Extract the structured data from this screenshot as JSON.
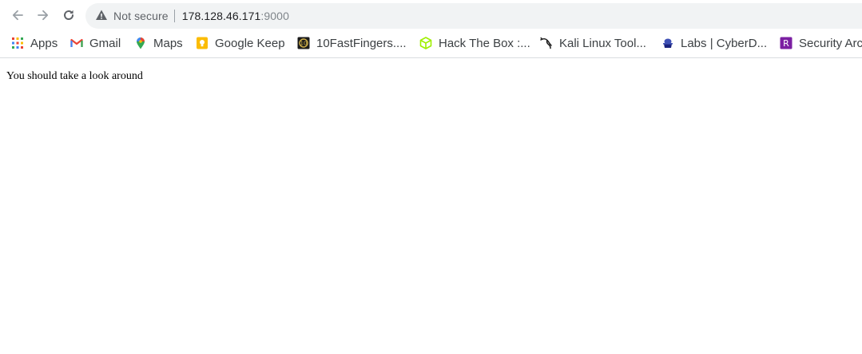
{
  "toolbar": {
    "back_icon": "arrow-left-icon",
    "forward_icon": "arrow-right-icon",
    "reload_icon": "reload-icon"
  },
  "omnibox": {
    "security_icon": "warning-icon",
    "security_label": "Not secure",
    "url_host": "178.128.46.171",
    "url_port": ":9000"
  },
  "bookmarks": [
    {
      "label": "Apps",
      "icon": "apps-grid-icon"
    },
    {
      "label": "Gmail",
      "icon": "gmail-icon"
    },
    {
      "label": "Maps",
      "icon": "maps-pin-icon"
    },
    {
      "label": "Google Keep",
      "icon": "keep-bulb-icon"
    },
    {
      "label": "10FastFingers....",
      "icon": "10fastfingers-icon"
    },
    {
      "label": "Hack The Box :...",
      "icon": "hackthebox-cube-icon"
    },
    {
      "label": "Kali Linux Tool...",
      "icon": "kali-dragon-icon"
    },
    {
      "label": "Labs | CyberD...",
      "icon": "cyberdefenders-icon"
    },
    {
      "label": "Security Arc",
      "icon": "security-arc-icon"
    }
  ],
  "page": {
    "message": "You should take a look around"
  },
  "colors": {
    "omnibox_bg": "#f1f3f4",
    "text": "#3c4043",
    "gmail_red": "#ea4335",
    "keep_yellow": "#fbbc04",
    "htb_green": "#9fef00",
    "security_arc_purple": "#7b1fa2"
  }
}
